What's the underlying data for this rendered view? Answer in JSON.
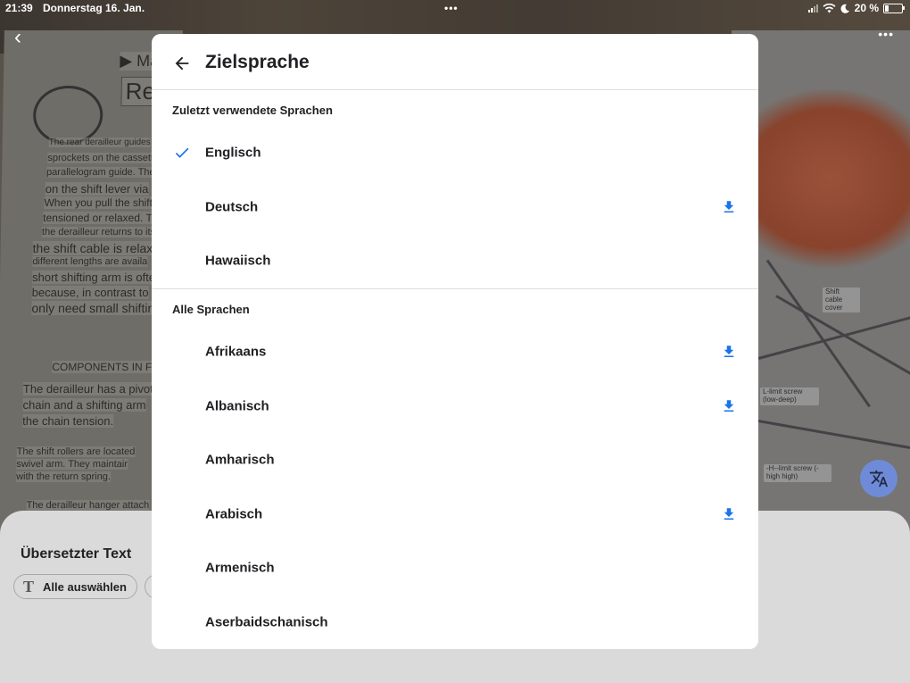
{
  "status_bar": {
    "time": "21:39",
    "date": "Donnerstag 16. Jan.",
    "battery": "20 %",
    "battery_level": 0.2
  },
  "background": {
    "page_heading_fragment": "▶ Ma",
    "page_heading_2": "Rea",
    "page_lines": [
      "The rear derailleur guides",
      "sprockets on the cassette",
      "parallelogram guide. The",
      "on the shift lever via",
      "When you pull the shift",
      "tensioned or relaxed. The",
      "the derailleur returns to its",
      "the shift cable is relax",
      "different lengths are availa",
      "short shifting arm is ofte",
      "because, in contrast to",
      "only need small shifting"
    ],
    "components_heading": "COMPONENTS IN F",
    "components_lines": [
      "The derailleur has a pivot ar",
      "chain and a shifting arm",
      "the chain tension."
    ],
    "rollers_lines": [
      "The shift rollers are located",
      "swivel arm. They maintair",
      "with the return spring."
    ],
    "hanger_line": "The derailleur hanger attach",
    "right_labels": [
      "Shift cable cover",
      "L-limit screw (low-deep)",
      "-H--limit screw (- high high)"
    ]
  },
  "dialog": {
    "title": "Zielsprache",
    "recent_section_label": "Zuletzt verwendete Sprachen",
    "recent_languages": [
      {
        "name": "Englisch",
        "selected": true,
        "downloadable": false
      },
      {
        "name": "Deutsch",
        "selected": false,
        "downloadable": true
      },
      {
        "name": "Hawaiisch",
        "selected": false,
        "downloadable": false
      }
    ],
    "all_section_label": "Alle Sprachen",
    "all_languages": [
      {
        "name": "Afrikaans",
        "downloadable": true
      },
      {
        "name": "Albanisch",
        "downloadable": true
      },
      {
        "name": "Amharisch",
        "downloadable": false
      },
      {
        "name": "Arabisch",
        "downloadable": true
      },
      {
        "name": "Armenisch",
        "downloadable": false
      },
      {
        "name": "Aserbaidschanisch",
        "downloadable": false
      }
    ]
  },
  "bottom_sheet": {
    "title": "Übersetzter Text",
    "select_all_label": "Alle auswählen"
  },
  "colors": {
    "accent": "#1a73e8",
    "fab": "#6f8bd8",
    "sheet": "#dadada"
  }
}
